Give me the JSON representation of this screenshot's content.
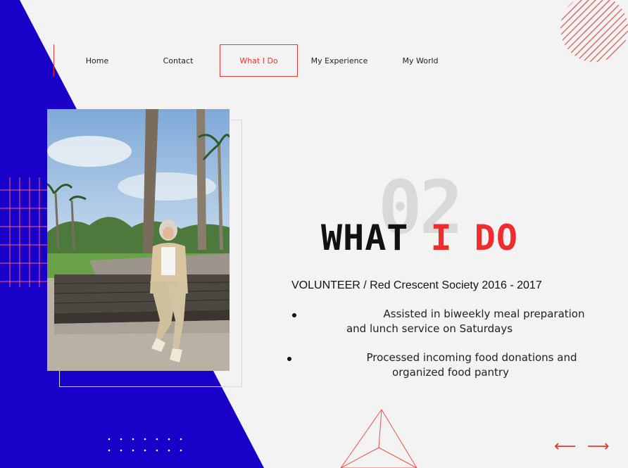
{
  "nav": {
    "items": [
      {
        "label": "Home",
        "active": false
      },
      {
        "label": "Contact",
        "active": false
      },
      {
        "label": "What I Do",
        "active": true
      },
      {
        "label": "My Experience",
        "active": false
      },
      {
        "label": "My World",
        "active": false
      }
    ]
  },
  "section": {
    "number": "02",
    "title_part1": "WHAT",
    "title_part2": "I DO",
    "role": "VOLUNTEER / Red Crescent Society 2016 - 2017",
    "items": [
      {
        "line1": "Assisted in biweekly meal preparation",
        "line2": "and lunch service on Saturdays"
      },
      {
        "line1": "Processed incoming food donations and",
        "line2": "organized food pantry"
      }
    ]
  },
  "controls": {
    "prev_arrow": "⟵",
    "next_arrow": "⟶"
  },
  "colors": {
    "accent": "#e53935",
    "blue": "#1a00c8",
    "background": "#f3f3f3"
  },
  "icons": {
    "prev": "arrow-left-icon",
    "next": "arrow-right-icon"
  }
}
